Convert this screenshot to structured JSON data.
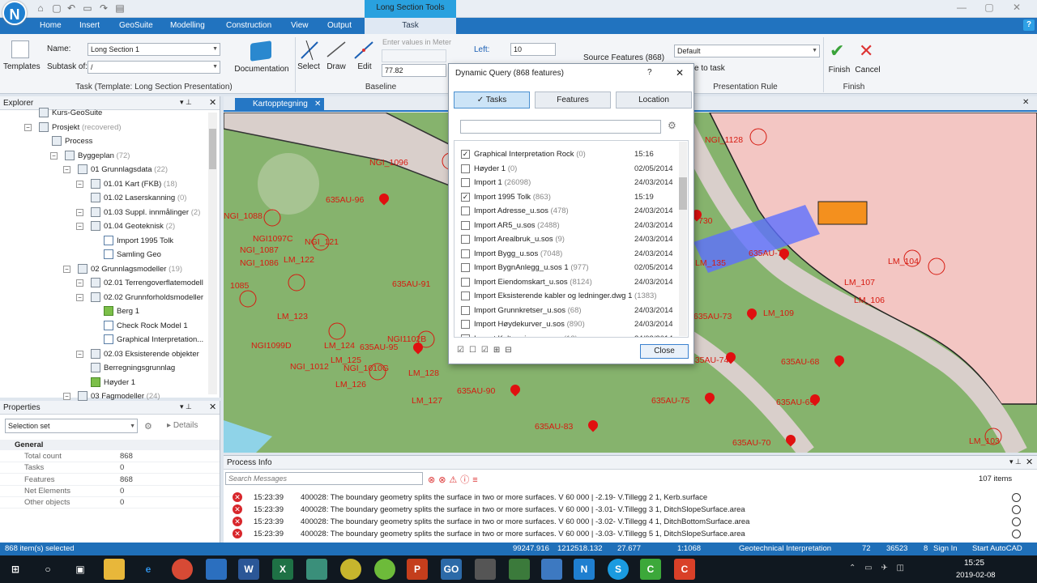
{
  "app": {
    "logo": "N",
    "context_tab": "Long Section Tools"
  },
  "menu": [
    "Home",
    "Insert",
    "GeoSuite",
    "Modelling",
    "Construction",
    "View",
    "Output",
    "Task"
  ],
  "help": "?",
  "ribbon": {
    "templates_label": "Templates",
    "name_label": "Name:",
    "name_value": "Long Section 1",
    "subtask_label": "Subtask of:",
    "subtask_value": "/",
    "documentation_label": "Documentation",
    "task_group": "Task  (Template: Long Section Presentation)",
    "select_label": "Select",
    "draw_label": "Draw",
    "edit_label": "Edit",
    "meter_placeholder": "Enter values in Meter",
    "baseline_value": "77.82",
    "baseline_group": "Baseline",
    "left_label": "Left:",
    "left_value": "10",
    "source_features": "Source Features (868)",
    "to_task": "e to task",
    "presentation_value": "Default",
    "presentation_group": "Presentation Rule",
    "finish_label": "Finish",
    "cancel_label": "Cancel",
    "finish_group": "Finish"
  },
  "explorer": {
    "title": "Explorer",
    "items": [
      {
        "label": "Kurs-GeoSuite",
        "count": ""
      },
      {
        "label": "Prosjekt",
        "count": "(recovered)"
      },
      {
        "label": "Process",
        "count": ""
      },
      {
        "label": "Byggeplan",
        "count": "(72)"
      },
      {
        "label": "01 Grunnlagsdata",
        "count": "(22)"
      },
      {
        "label": "01.01 Kart (FKB)",
        "count": "(18)"
      },
      {
        "label": "01.02 Laserskanning",
        "count": "(0)"
      },
      {
        "label": "01.03 Suppl. innmålinger",
        "count": "(2)"
      },
      {
        "label": "01.04 Geoteknisk",
        "count": "(2)"
      },
      {
        "label": "Import 1995 Tolk",
        "count": ""
      },
      {
        "label": "Samling Geo",
        "count": ""
      },
      {
        "label": "02 Grunnlagsmodeller",
        "count": "(19)"
      },
      {
        "label": "02.01 Terrengoverflatemodell",
        "count": ""
      },
      {
        "label": "02.02 Grunnforholdsmodeller",
        "count": ""
      },
      {
        "label": "Berg 1",
        "count": ""
      },
      {
        "label": "Check Rock Model 1",
        "count": ""
      },
      {
        "label": "Graphical Interpretation...",
        "count": ""
      },
      {
        "label": "02.03 Eksisterende objekter",
        "count": ""
      },
      {
        "label": "Berregningsgrunnlag",
        "count": ""
      },
      {
        "label": "Høyder 1",
        "count": ""
      },
      {
        "label": "03 Fagmodeller",
        "count": "(24)"
      }
    ]
  },
  "properties": {
    "title": "Properties",
    "selection": "Selection set",
    "details": "Details",
    "section": "General",
    "rows": [
      {
        "k": "Total count",
        "v": "868"
      },
      {
        "k": "Tasks",
        "v": "0"
      },
      {
        "k": "Features",
        "v": "868"
      },
      {
        "k": "Net Elements",
        "v": "0"
      },
      {
        "k": "Other objects",
        "v": "0"
      }
    ]
  },
  "map": {
    "tab": "Kartopptegning",
    "labels": [
      "NGI_1096",
      "635AU-96",
      "NGI_1088",
      "NGI1097C",
      "NGI_1087",
      "NGI_1086",
      "NGI_121",
      "LM_122",
      "1085",
      "LM_123",
      "NGI1099D",
      "NGI1102B",
      "LM_124",
      "635AU-95",
      "LM_125",
      "NGI_1012",
      "NGI_1010G",
      "LM_126",
      "LM_128",
      "LM_127",
      "635AU-90",
      "635AU-83",
      "635AU-91",
      "635AU-75",
      "635AU-69",
      "635AU-70",
      "635AU-68",
      "635AU-73",
      "635AU-74",
      "635AU-72",
      "LM_135",
      "LM_109",
      "LM_107",
      "LM_106",
      "LM_104",
      "LM_103",
      "NGI_1128",
      "730"
    ]
  },
  "dialog": {
    "title": "Dynamic Query (868 features)",
    "help": "?",
    "tabs": [
      "Tasks",
      "Features",
      "Location"
    ],
    "rows": [
      {
        "name": "Graphical Interpretation Rock",
        "count": "(0)",
        "date": "15:16",
        "checked": true
      },
      {
        "name": "Høyder 1",
        "count": "(0)",
        "date": "02/05/2014",
        "checked": false
      },
      {
        "name": "Import 1",
        "count": "(26098)",
        "date": "24/03/2014",
        "checked": false
      },
      {
        "name": "Import 1995 Tolk",
        "count": "(863)",
        "date": "15:19",
        "checked": true
      },
      {
        "name": "Import Adresse_u.sos",
        "count": "(478)",
        "date": "24/03/2014",
        "checked": false
      },
      {
        "name": "Import AR5_u.sos",
        "count": "(2488)",
        "date": "24/03/2014",
        "checked": false
      },
      {
        "name": "Import Arealbruk_u.sos",
        "count": "(9)",
        "date": "24/03/2014",
        "checked": false
      },
      {
        "name": "Import Bygg_u.sos",
        "count": "(7048)",
        "date": "24/03/2014",
        "checked": false
      },
      {
        "name": "Import BygnAnlegg_u.sos 1",
        "count": "(977)",
        "date": "02/05/2014",
        "checked": false
      },
      {
        "name": "Import Eiendomskart_u.sos",
        "count": "(8124)",
        "date": "24/03/2014",
        "checked": false
      },
      {
        "name": "Import Eksisterende kabler og ledninger.dwg 1",
        "count": "(1383)",
        "date": "",
        "checked": false
      },
      {
        "name": "Import Grunnkretser_u.sos",
        "count": "(68)",
        "date": "24/03/2014",
        "checked": false
      },
      {
        "name": "Import Høydekurver_u.sos",
        "count": "(890)",
        "date": "24/03/2014",
        "checked": false
      },
      {
        "name": "Import Kulturminne_u.sos",
        "count": "(13)",
        "date": "24/03/2014",
        "checked": false
      }
    ],
    "close": "Close"
  },
  "process": {
    "title": "Process Info",
    "search_placeholder": "Search Messages",
    "count": "107 items",
    "rows": [
      {
        "time": "15:23:39",
        "msg": "400028: The boundary geometry splits the surface in two or more surfaces. V 60 000 | -2.19- V.Tillegg 2 1, Kerb.surface"
      },
      {
        "time": "15:23:39",
        "msg": "400028: The boundary geometry splits the surface in two or more surfaces. V 60 000 | -3.01- V.Tillegg 3 1, DitchSlopeSurface.area"
      },
      {
        "time": "15:23:39",
        "msg": "400028: The boundary geometry splits the surface in two or more surfaces. V 60 000 | -3.02- V.Tillegg 4 1, DitchBottomSurface.area"
      },
      {
        "time": "15:23:39",
        "msg": "400028: The boundary geometry splits the surface in two or more surfaces. V 60 000 | -3.03- V.Tillegg 5 1, DitchSlopeSurface.area"
      }
    ]
  },
  "status": {
    "selected": "868 item(s) selected",
    "x": "99247.916",
    "y": "1212518.132",
    "z": "27.677",
    "scale": "1:1068",
    "mode": "Geotechnical Interpretation",
    "n1": "72",
    "n2": "36523",
    "n3": "8",
    "signin": "Sign In",
    "autocad": "Start AutoCAD"
  },
  "taskbar": {
    "time": "15:25",
    "date": "2019-02-08"
  }
}
